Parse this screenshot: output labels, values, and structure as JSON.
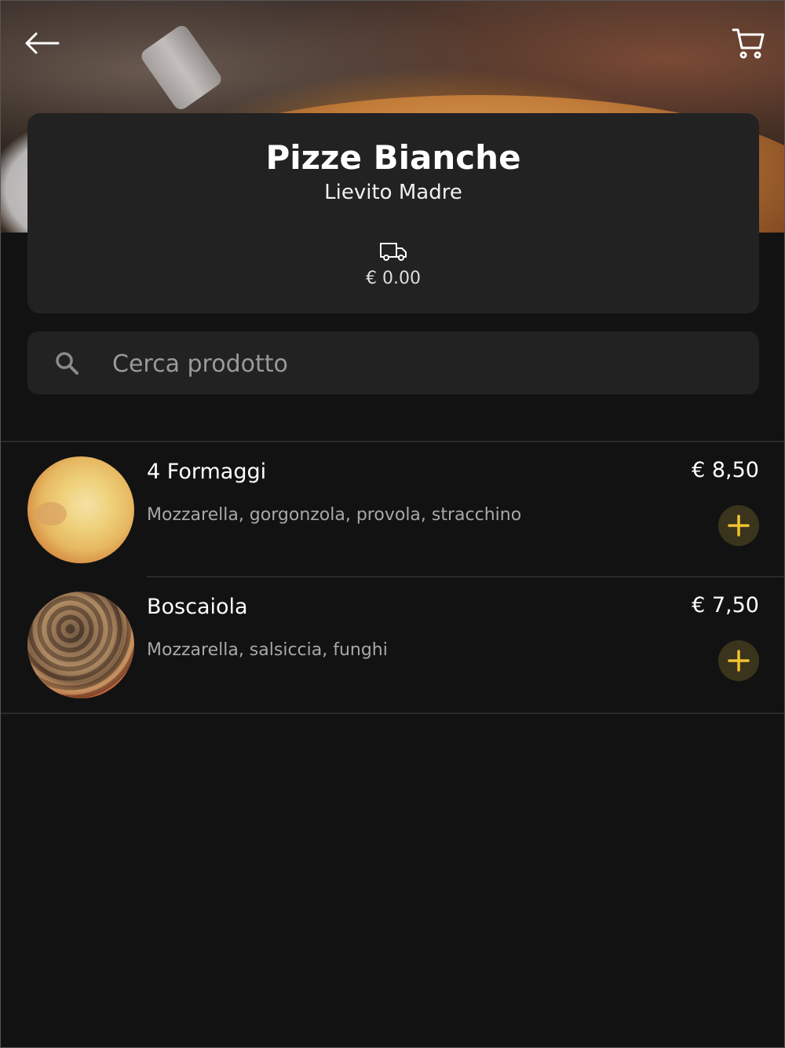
{
  "header": {
    "back_icon": "arrow-left-icon",
    "cart_icon": "cart-icon"
  },
  "category": {
    "title": "Pizze Bianche",
    "subtitle": "Lievito Madre",
    "delivery_icon": "truck-icon",
    "delivery_cost": "€ 0.00"
  },
  "search": {
    "placeholder": "Cerca prodotto",
    "icon": "search-icon"
  },
  "products": [
    {
      "name": "4 Formaggi",
      "description": "Mozzarella, gorgonzola, provola, stracchino",
      "price": "€ 8,50"
    },
    {
      "name": "Boscaiola",
      "description": "Mozzarella, salsiccia, funghi",
      "price": "€ 7,50"
    }
  ],
  "colors": {
    "background": "#121212",
    "card": "#222222",
    "accent": "#f2c230",
    "add_button_bg": "#3a341c"
  }
}
